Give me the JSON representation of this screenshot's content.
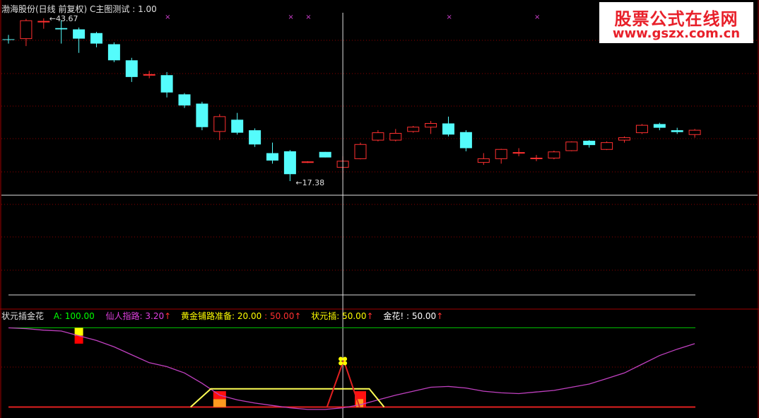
{
  "upper_header": {
    "title": "渤海股份(日线 前复权)",
    "indicator": "C主图测试",
    "value": ": 1.00"
  },
  "lower_header": {
    "name": "状元插金花",
    "items": [
      {
        "label": "A:",
        "value": "100.00",
        "arrow": "",
        "color": "#00ff00"
      },
      {
        "label": "仙人指路:",
        "value": "3.20",
        "arrow": "↑",
        "color": "#e040e0"
      },
      {
        "label": "黄金铺路准备:",
        "value": "20.00",
        "arrow": "",
        "color": "#ffff00"
      },
      {
        "label": ":",
        "value": "50.00",
        "arrow": "↑",
        "color": "#ff3030"
      },
      {
        "label": "状元插:",
        "value": "50.00",
        "arrow": "↑",
        "color": "#ffff00"
      },
      {
        "label": "金花!",
        "value": ": 50.00",
        "arrow": "↑",
        "color": "#ffffff"
      }
    ]
  },
  "watermark": {
    "line1": "股票公式在线网",
    "line2": "www.gszx.com.cn"
  },
  "colors": {
    "up": "#ff3030",
    "down": "#54fcfc",
    "grid": "#8b0000",
    "axis": "#a00000",
    "crosshair": "#e0e0e0",
    "xian_ren": "#c040c0",
    "yellow": "#ffff55",
    "red_line": "#e02020",
    "green_line": "#00c000"
  },
  "chart_data": [
    {
      "type": "candlestick",
      "title": "渤海股份(日线 前复权)",
      "ylim": [
        13.5,
        45.5
      ],
      "annotations": [
        {
          "label": "43.67",
          "bar": 2,
          "value": 43.67,
          "kind": "high"
        },
        {
          "label": "17.38",
          "bar": 16,
          "value": 17.38,
          "kind": "low"
        }
      ],
      "crosshair": {
        "bar": 19,
        "value": 18.2
      },
      "markers_x": [
        9,
        16,
        17,
        25,
        30
      ],
      "bars": [
        {
          "o": 40.3,
          "h": 41.0,
          "l": 39.6,
          "c": 40.2
        },
        {
          "o": 40.4,
          "h": 43.6,
          "l": 39.2,
          "c": 43.3
        },
        {
          "o": 43.2,
          "h": 43.67,
          "l": 42.0,
          "c": 43.2
        },
        {
          "o": 42.1,
          "h": 43.4,
          "l": 39.6,
          "c": 41.9
        },
        {
          "o": 41.9,
          "h": 42.2,
          "l": 38.1,
          "c": 40.4
        },
        {
          "o": 41.3,
          "h": 41.5,
          "l": 39.0,
          "c": 39.6
        },
        {
          "o": 39.5,
          "h": 39.8,
          "l": 36.6,
          "c": 36.9
        },
        {
          "o": 36.9,
          "h": 37.3,
          "l": 33.4,
          "c": 34.2
        },
        {
          "o": 34.5,
          "h": 35.2,
          "l": 34.0,
          "c": 34.6
        },
        {
          "o": 34.5,
          "h": 35.0,
          "l": 30.9,
          "c": 31.7
        },
        {
          "o": 31.4,
          "h": 31.6,
          "l": 29.2,
          "c": 29.6
        },
        {
          "o": 29.9,
          "h": 30.2,
          "l": 25.6,
          "c": 26.1
        },
        {
          "o": 25.4,
          "h": 28.2,
          "l": 24.0,
          "c": 27.8
        },
        {
          "o": 27.3,
          "h": 28.4,
          "l": 24.9,
          "c": 25.2
        },
        {
          "o": 25.6,
          "h": 25.9,
          "l": 22.9,
          "c": 23.3
        },
        {
          "o": 21.9,
          "h": 23.6,
          "l": 20.2,
          "c": 20.7
        },
        {
          "o": 22.2,
          "h": 22.4,
          "l": 17.38,
          "c": 18.5
        },
        {
          "o": 20.5,
          "h": 20.6,
          "l": 20.3,
          "c": 20.5
        },
        {
          "o": 22.1,
          "h": 22.1,
          "l": 21.2,
          "c": 21.2
        },
        {
          "o": 19.6,
          "h": 21.4,
          "l": 17.6,
          "c": 20.6
        },
        {
          "o": 21.0,
          "h": 23.6,
          "l": 20.9,
          "c": 23.3
        },
        {
          "o": 24.0,
          "h": 25.6,
          "l": 23.8,
          "c": 25.2
        },
        {
          "o": 24.0,
          "h": 25.8,
          "l": 23.8,
          "c": 25.1
        },
        {
          "o": 25.4,
          "h": 26.3,
          "l": 25.2,
          "c": 26.1
        },
        {
          "o": 26.1,
          "h": 27.1,
          "l": 25.0,
          "c": 26.7
        },
        {
          "o": 26.7,
          "h": 27.8,
          "l": 24.6,
          "c": 24.9
        },
        {
          "o": 25.3,
          "h": 25.6,
          "l": 22.2,
          "c": 22.7
        },
        {
          "o": 20.4,
          "h": 21.9,
          "l": 20.0,
          "c": 21.0
        },
        {
          "o": 21.0,
          "h": 22.6,
          "l": 20.2,
          "c": 22.5
        },
        {
          "o": 22.0,
          "h": 22.7,
          "l": 21.4,
          "c": 22.0
        },
        {
          "o": 21.0,
          "h": 21.6,
          "l": 20.6,
          "c": 21.1
        },
        {
          "o": 21.1,
          "h": 22.3,
          "l": 20.9,
          "c": 22.1
        },
        {
          "o": 22.3,
          "h": 23.8,
          "l": 22.2,
          "c": 23.7
        },
        {
          "o": 23.9,
          "h": 24.0,
          "l": 22.8,
          "c": 23.2
        },
        {
          "o": 22.5,
          "h": 23.8,
          "l": 22.4,
          "c": 23.6
        },
        {
          "o": 24.0,
          "h": 24.6,
          "l": 23.6,
          "c": 24.4
        },
        {
          "o": 25.2,
          "h": 26.6,
          "l": 25.0,
          "c": 26.4
        },
        {
          "o": 26.6,
          "h": 26.8,
          "l": 25.6,
          "c": 26.0
        },
        {
          "o": 25.6,
          "h": 26.0,
          "l": 25.0,
          "c": 25.3
        },
        {
          "o": 24.9,
          "h": 25.8,
          "l": 24.4,
          "c": 25.6
        }
      ]
    },
    {
      "type": "line",
      "title": "状元插金花",
      "ylim": [
        -4,
        104
      ],
      "reference_lines": [
        {
          "name": "A",
          "value": 100
        },
        {
          "name": "baseline",
          "value": 0
        }
      ],
      "series": [
        {
          "name": "仙人指路",
          "x": [
            0,
            1,
            2,
            3,
            4,
            5,
            6,
            7,
            8,
            9,
            10,
            11,
            12,
            13,
            14,
            15,
            16,
            17,
            18,
            19,
            20,
            21,
            22,
            23,
            24,
            25,
            26,
            27,
            28,
            29,
            30,
            31,
            32,
            33,
            34,
            35,
            36,
            37,
            38,
            39
          ],
          "values": [
            100,
            99,
            97,
            96,
            90,
            84,
            76,
            66,
            56,
            51,
            43,
            30,
            15,
            9,
            5,
            2,
            -1,
            -3,
            -3,
            -1,
            3,
            9,
            15,
            20,
            25,
            26,
            24,
            20,
            18,
            17,
            19,
            21,
            25,
            29,
            36,
            43,
            54,
            65,
            73,
            80
          ]
        },
        {
          "name": "黄金铺路准备",
          "x": [
            10.35,
            11.5,
            20.5,
            21.35
          ],
          "values": [
            0,
            23,
            23,
            0
          ]
        },
        {
          "name": "状元插",
          "x": [
            18.1,
            19.05,
            19.95
          ],
          "values": [
            0,
            59,
            0
          ]
        }
      ],
      "events": [
        {
          "name": "仙人指路",
          "bar": 4,
          "value_top": 100,
          "value_mid": 90,
          "value_bottom": 80
        },
        {
          "name": "黄金铺路准备",
          "bar": 12,
          "value_top": 20,
          "value_mid": 10,
          "value_bottom": 0
        },
        {
          "name": "状元插",
          "bar": 20,
          "value_top": 20,
          "value_mid": 10,
          "value_bottom": 0
        }
      ],
      "flower": {
        "name": "金花!",
        "bar": 19,
        "value": 58
      }
    }
  ]
}
